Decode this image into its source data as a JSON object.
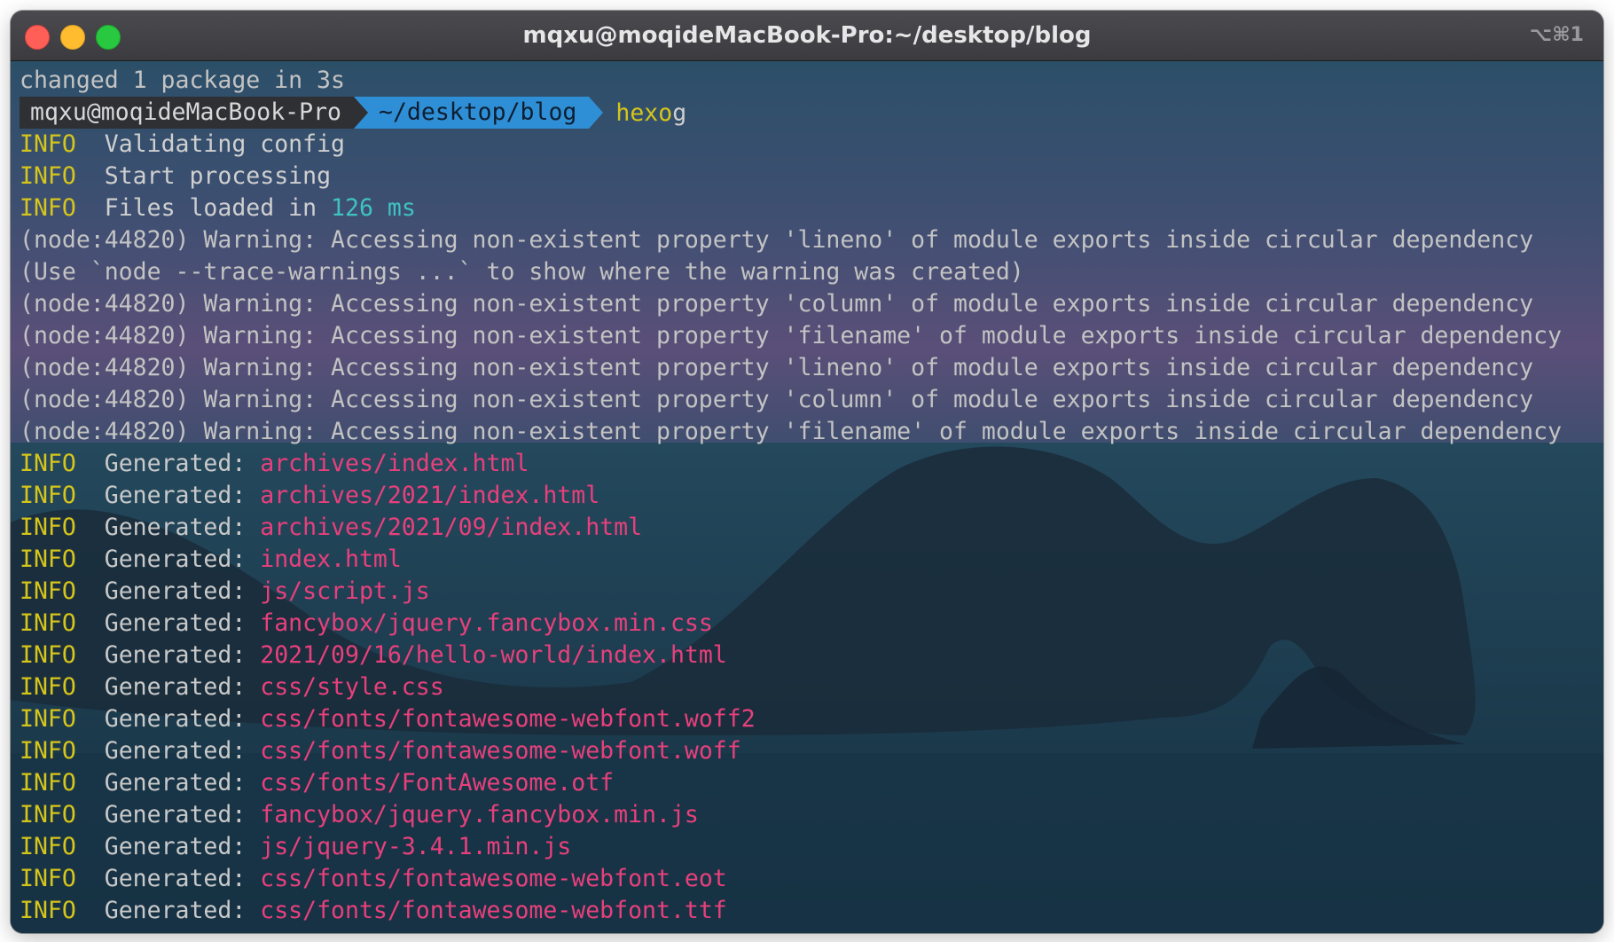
{
  "window": {
    "title": "mqxu@moqideMacBook-Pro:~/desktop/blog",
    "shortcut": "⌥⌘1"
  },
  "terminal": {
    "line_changed": "changed 1 package in 3s",
    "prompt": {
      "user_host": "mqxu@moqideMacBook-Pro",
      "path": "~/desktop/blog",
      "command": "hexo",
      "argument": "g"
    },
    "info_tag": "INFO",
    "info_lines": [
      "Validating config",
      "Start processing"
    ],
    "files_loaded": {
      "prefix": "Files loaded in",
      "value": "126 ms"
    },
    "warnings": [
      "(node:44820) Warning: Accessing non-existent property 'lineno' of module exports inside circular dependency",
      "(Use `node --trace-warnings ...` to show where the warning was created)",
      "(node:44820) Warning: Accessing non-existent property 'column' of module exports inside circular dependency",
      "(node:44820) Warning: Accessing non-existent property 'filename' of module exports inside circular dependency",
      "(node:44820) Warning: Accessing non-existent property 'lineno' of module exports inside circular dependency",
      "(node:44820) Warning: Accessing non-existent property 'column' of module exports inside circular dependency",
      "(node:44820) Warning: Accessing non-existent property 'filename' of module exports inside circular dependency"
    ],
    "generated_label": "Generated:",
    "generated_files": [
      "archives/index.html",
      "archives/2021/index.html",
      "archives/2021/09/index.html",
      "index.html",
      "js/script.js",
      "fancybox/jquery.fancybox.min.css",
      "2021/09/16/hello-world/index.html",
      "css/style.css",
      "css/fonts/fontawesome-webfont.woff2",
      "css/fonts/fontawesome-webfont.woff",
      "css/fonts/FontAwesome.otf",
      "fancybox/jquery.fancybox.min.js",
      "js/jquery-3.4.1.min.js",
      "css/fonts/fontawesome-webfont.eot",
      "css/fonts/fontawesome-webfont.ttf"
    ]
  },
  "colors": {
    "info": "#d6c51a",
    "file": "#e8407c",
    "number": "#3fc2c2",
    "path_segment": "#2f8fd6",
    "user_segment": "#2e3033"
  }
}
